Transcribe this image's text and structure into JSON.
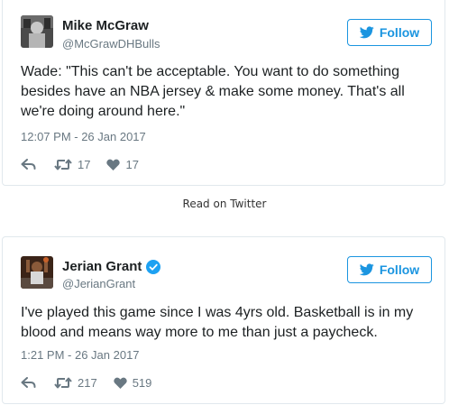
{
  "accent_color": "#1b95e0",
  "tweets": [
    {
      "author": "Mike McGraw",
      "handle": "@McGrawDHBulls",
      "verified": false,
      "follow_label": "Follow",
      "text": "Wade: \"This can't be acceptable. You want to do something besides have an NBA jersey & make some money. That's all we're doing around here.\"",
      "timestamp": "12:07 PM - 26 Jan 2017",
      "retweets": "17",
      "likes": "17",
      "icons": [
        "twitter-bird-icon",
        "reply-icon",
        "retweet-icon",
        "heart-icon"
      ]
    },
    {
      "author": "Jerian Grant",
      "handle": "@JerianGrant",
      "verified": true,
      "follow_label": "Follow",
      "text": "I've played this game since I was 4yrs old. Basketball is in my blood and means way more to me than just a paycheck.",
      "timestamp": "1:21 PM - 26 Jan 2017",
      "retweets": "217",
      "likes": "519",
      "icons": [
        "verified-badge-icon",
        "twitter-bird-icon",
        "reply-icon",
        "retweet-icon",
        "heart-icon"
      ]
    }
  ],
  "read_on_twitter": "Read on Twitter"
}
